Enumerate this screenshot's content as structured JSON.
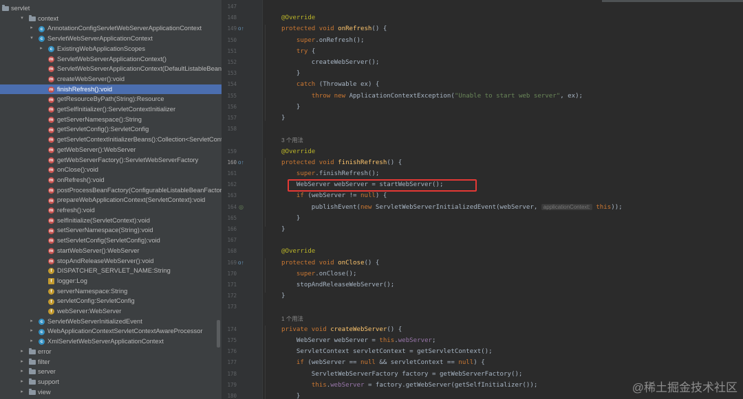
{
  "tree": {
    "rows": [
      {
        "label": "servlet",
        "icon": "folder",
        "arrow": "",
        "selected": false
      },
      {
        "label": "context",
        "icon": "folder",
        "arrow": "▾",
        "selected": false
      },
      {
        "label": "AnnotationConfigServletWebServerApplicationContext",
        "icon": "class",
        "arrow": "▸",
        "selected": false
      },
      {
        "label": "ServletWebServerApplicationContext",
        "icon": "class",
        "arrow": "▾",
        "selected": false
      },
      {
        "label": "ExistingWebApplicationScopes",
        "icon": "class",
        "arrow": "▸",
        "selected": false
      },
      {
        "label": "ServletWebServerApplicationContext()",
        "icon": "method",
        "arrow": "",
        "selected": false
      },
      {
        "label": "ServletWebServerApplicationContext(DefaultListableBeanFactory",
        "icon": "method",
        "arrow": "",
        "selected": false
      },
      {
        "label": "createWebServer():void",
        "icon": "method",
        "arrow": "",
        "selected": false
      },
      {
        "label": "finishRefresh():void",
        "icon": "method",
        "arrow": "",
        "selected": true
      },
      {
        "label": "getResourceByPath(String):Resource",
        "icon": "method",
        "arrow": "",
        "selected": false
      },
      {
        "label": "getSelfInitializer():ServletContextInitializer",
        "icon": "method",
        "arrow": "",
        "selected": false
      },
      {
        "label": "getServerNamespace():String",
        "icon": "method",
        "arrow": "",
        "selected": false
      },
      {
        "label": "getServletConfig():ServletConfig",
        "icon": "method",
        "arrow": "",
        "selected": false
      },
      {
        "label": "getServletContextInitializerBeans():Collection<ServletContextIni",
        "icon": "method",
        "arrow": "",
        "selected": false
      },
      {
        "label": "getWebServer():WebServer",
        "icon": "method",
        "arrow": "",
        "selected": false
      },
      {
        "label": "getWebServerFactory():ServletWebServerFactory",
        "icon": "method",
        "arrow": "",
        "selected": false
      },
      {
        "label": "onClose():void",
        "icon": "method",
        "arrow": "",
        "selected": false
      },
      {
        "label": "onRefresh():void",
        "icon": "method",
        "arrow": "",
        "selected": false
      },
      {
        "label": "postProcessBeanFactory(ConfigurableListableBeanFactory):void",
        "icon": "method",
        "arrow": "",
        "selected": false
      },
      {
        "label": "prepareWebApplicationContext(ServletContext):void",
        "icon": "method",
        "arrow": "",
        "selected": false
      },
      {
        "label": "refresh():void",
        "icon": "method",
        "arrow": "",
        "selected": false
      },
      {
        "label": "selfInitialize(ServletContext):void",
        "icon": "method",
        "arrow": "",
        "selected": false
      },
      {
        "label": "setServerNamespace(String):void",
        "icon": "method",
        "arrow": "",
        "selected": false
      },
      {
        "label": "setServletConfig(ServletConfig):void",
        "icon": "method",
        "arrow": "",
        "selected": false
      },
      {
        "label": "startWebServer():WebServer",
        "icon": "method",
        "arrow": "",
        "selected": false
      },
      {
        "label": "stopAndReleaseWebServer():void",
        "icon": "method",
        "arrow": "",
        "selected": false
      },
      {
        "label": "DISPATCHER_SERVLET_NAME:String",
        "icon": "field",
        "arrow": "",
        "selected": false
      },
      {
        "label": "logger:Log",
        "icon": "field-sq",
        "arrow": "",
        "selected": false
      },
      {
        "label": "serverNamespace:String",
        "icon": "field",
        "arrow": "",
        "selected": false
      },
      {
        "label": "servletConfig:ServletConfig",
        "icon": "field",
        "arrow": "",
        "selected": false
      },
      {
        "label": "webServer:WebServer",
        "icon": "field",
        "arrow": "",
        "selected": false
      },
      {
        "label": "ServletWebServerInitializedEvent",
        "icon": "class",
        "arrow": "▸",
        "selected": false
      },
      {
        "label": "WebApplicationContextServletContextAwareProcessor",
        "icon": "class",
        "arrow": "▸",
        "selected": false
      },
      {
        "label": "XmlServletWebServerApplicationContext",
        "icon": "class",
        "arrow": "▸",
        "selected": false
      },
      {
        "label": "error",
        "icon": "folder",
        "arrow": "▸",
        "selected": false
      },
      {
        "label": "filter",
        "icon": "folder",
        "arrow": "▸",
        "selected": false
      },
      {
        "label": "server",
        "icon": "folder",
        "arrow": "▸",
        "selected": false
      },
      {
        "label": "support",
        "icon": "folder",
        "arrow": "▸",
        "selected": false
      },
      {
        "label": "view",
        "icon": "folder",
        "arrow": "▸",
        "selected": false
      }
    ]
  },
  "editor": {
    "lines": [
      {
        "num": "147",
        "tokens": []
      },
      {
        "num": "148",
        "tokens": [
          {
            "c": "a",
            "t": "@Override"
          }
        ]
      },
      {
        "num": "149",
        "tokens": [
          {
            "c": "k",
            "t": "protected void "
          },
          {
            "c": "m",
            "t": "onRefresh"
          },
          {
            "c": "",
            "t": "() {"
          }
        ]
      },
      {
        "num": "150",
        "tokens": [
          {
            "c": "",
            "t": "    "
          },
          {
            "c": "k",
            "t": "super"
          },
          {
            "c": "",
            "t": ".onRefresh();"
          }
        ]
      },
      {
        "num": "151",
        "tokens": [
          {
            "c": "",
            "t": "    "
          },
          {
            "c": "k",
            "t": "try "
          },
          {
            "c": "",
            "t": "{"
          }
        ]
      },
      {
        "num": "152",
        "tokens": [
          {
            "c": "",
            "t": "        createWebServer();"
          }
        ]
      },
      {
        "num": "153",
        "tokens": [
          {
            "c": "",
            "t": "    }"
          }
        ]
      },
      {
        "num": "154",
        "tokens": [
          {
            "c": "",
            "t": "    "
          },
          {
            "c": "k",
            "t": "catch "
          },
          {
            "c": "",
            "t": "(Throwable ex) {"
          }
        ]
      },
      {
        "num": "155",
        "tokens": [
          {
            "c": "",
            "t": "        "
          },
          {
            "c": "k",
            "t": "throw new "
          },
          {
            "c": "",
            "t": "ApplicationContextException("
          },
          {
            "c": "s",
            "t": "\"Unable to start web server\""
          },
          {
            "c": "",
            "t": ", ex);"
          }
        ]
      },
      {
        "num": "156",
        "tokens": [
          {
            "c": "",
            "t": "    }"
          }
        ]
      },
      {
        "num": "157",
        "tokens": [
          {
            "c": "",
            "t": "}"
          }
        ]
      },
      {
        "num": "158",
        "tokens": []
      },
      {
        "num": "",
        "usage": "3 个用法",
        "tokens": []
      },
      {
        "num": "159",
        "tokens": [
          {
            "c": "a",
            "t": "@Override"
          }
        ]
      },
      {
        "num": "160",
        "tokens": [
          {
            "c": "k",
            "t": "protected void "
          },
          {
            "c": "m",
            "t": "finishRefresh"
          },
          {
            "c": "",
            "t": "() {"
          }
        ]
      },
      {
        "num": "161",
        "tokens": [
          {
            "c": "",
            "t": "    "
          },
          {
            "c": "k",
            "t": "super"
          },
          {
            "c": "",
            "t": ".finishRefresh();"
          }
        ]
      },
      {
        "num": "162",
        "tokens": [
          {
            "c": "",
            "t": "    WebServer webServer = startWebServer();"
          }
        ]
      },
      {
        "num": "163",
        "tokens": [
          {
            "c": "",
            "t": "    "
          },
          {
            "c": "k",
            "t": "if "
          },
          {
            "c": "",
            "t": "(webServer != "
          },
          {
            "c": "k",
            "t": "null"
          },
          {
            "c": "",
            "t": ") {"
          }
        ]
      },
      {
        "num": "164",
        "tokens": [
          {
            "c": "",
            "t": "        publishEvent("
          },
          {
            "c": "k",
            "t": "new "
          },
          {
            "c": "",
            "t": "ServletWebServerInitializedEvent(webServer, "
          },
          {
            "c": "hint",
            "t": "applicationContext:"
          },
          {
            "c": "",
            "t": " "
          },
          {
            "c": "k",
            "t": "this"
          },
          {
            "c": "",
            "t": "));"
          }
        ]
      },
      {
        "num": "165",
        "tokens": [
          {
            "c": "",
            "t": "    }"
          }
        ]
      },
      {
        "num": "166",
        "tokens": [
          {
            "c": "",
            "t": "}"
          }
        ]
      },
      {
        "num": "167",
        "tokens": []
      },
      {
        "num": "168",
        "tokens": [
          {
            "c": "a",
            "t": "@Override"
          }
        ]
      },
      {
        "num": "169",
        "tokens": [
          {
            "c": "k",
            "t": "protected void "
          },
          {
            "c": "m",
            "t": "onClose"
          },
          {
            "c": "",
            "t": "() {"
          }
        ]
      },
      {
        "num": "170",
        "tokens": [
          {
            "c": "",
            "t": "    "
          },
          {
            "c": "k",
            "t": "super"
          },
          {
            "c": "",
            "t": ".onClose();"
          }
        ]
      },
      {
        "num": "171",
        "tokens": [
          {
            "c": "",
            "t": "    stopAndReleaseWebServer();"
          }
        ]
      },
      {
        "num": "172",
        "tokens": [
          {
            "c": "",
            "t": "}"
          }
        ]
      },
      {
        "num": "173",
        "tokens": []
      },
      {
        "num": "",
        "usage": "1 个用法",
        "tokens": []
      },
      {
        "num": "174",
        "tokens": [
          {
            "c": "k",
            "t": "private void "
          },
          {
            "c": "m",
            "t": "createWebServer"
          },
          {
            "c": "",
            "t": "() {"
          }
        ]
      },
      {
        "num": "175",
        "tokens": [
          {
            "c": "",
            "t": "    WebServer webServer = "
          },
          {
            "c": "k",
            "t": "this"
          },
          {
            "c": "",
            "t": "."
          },
          {
            "c": "f",
            "t": "webServer"
          },
          {
            "c": "",
            "t": ";"
          }
        ]
      },
      {
        "num": "176",
        "tokens": [
          {
            "c": "",
            "t": "    ServletContext servletContext = getServletContext();"
          }
        ]
      },
      {
        "num": "177",
        "tokens": [
          {
            "c": "",
            "t": "    "
          },
          {
            "c": "k",
            "t": "if "
          },
          {
            "c": "",
            "t": "(webServer == "
          },
          {
            "c": "k",
            "t": "null "
          },
          {
            "c": "",
            "t": "&& servletContext == "
          },
          {
            "c": "k",
            "t": "null"
          },
          {
            "c": "",
            "t": ") {"
          }
        ]
      },
      {
        "num": "178",
        "tokens": [
          {
            "c": "",
            "t": "        ServletWebServerFactory factory = getWebServerFactory();"
          }
        ]
      },
      {
        "num": "179",
        "tokens": [
          {
            "c": "",
            "t": "        "
          },
          {
            "c": "k",
            "t": "this"
          },
          {
            "c": "",
            "t": "."
          },
          {
            "c": "f",
            "t": "webServer"
          },
          {
            "c": "",
            "t": " = factory.getWebServer(getSelfInitializer());"
          }
        ]
      },
      {
        "num": "180",
        "tokens": [
          {
            "c": "",
            "t": "    }"
          }
        ]
      }
    ]
  },
  "watermark": "@稀土掘金技术社区"
}
